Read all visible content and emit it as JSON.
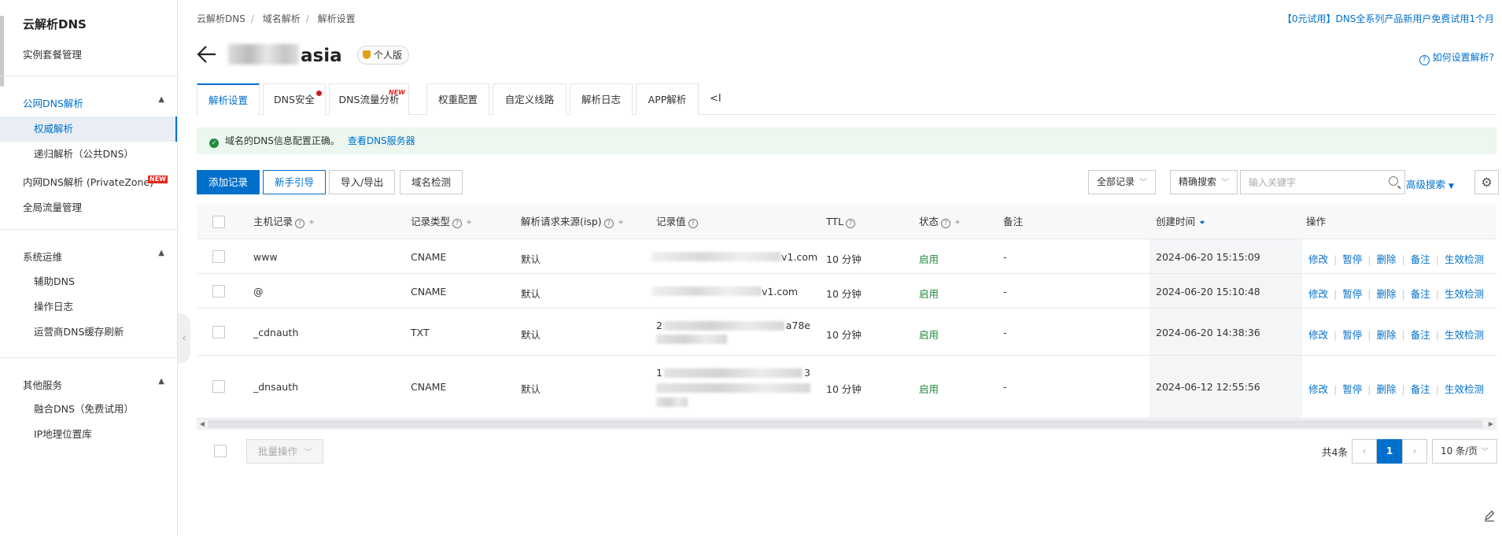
{
  "sidebar": {
    "title": "云解析DNS",
    "instance_link": "实例套餐管理",
    "groups": [
      {
        "label": "公网DNS解析",
        "items": [
          "权威解析",
          "递归解析（公共DNS）"
        ]
      },
      {
        "label": "内网DNS解析 (PrivateZone)",
        "badge": "NEW"
      },
      {
        "label": "全局流量管理"
      },
      {
        "label": "系统运维",
        "items": [
          "辅助DNS",
          "操作日志",
          "运营商DNS缓存刷新"
        ]
      },
      {
        "label": "其他服务",
        "items": [
          "融合DNS（免费试用）",
          "IP地理位置库"
        ]
      }
    ]
  },
  "breadcrumb": [
    "云解析DNS",
    "域名解析",
    "解析设置"
  ],
  "promo": "【0元试用】DNS全系列产品新用户免费试用1个月",
  "domain": {
    "visible_suffix": "asia",
    "edition": "个人版"
  },
  "help_link": "如何设置解析?",
  "tabs": [
    {
      "label": "解析设置",
      "active": true
    },
    {
      "label": "DNS安全",
      "dot": true
    },
    {
      "label": "DNS流量分析",
      "new": "NEW"
    },
    {
      "label": "权重配置"
    },
    {
      "label": "自定义线路"
    },
    {
      "label": "解析日志"
    },
    {
      "label": "APP解析"
    }
  ],
  "tab_collapse": "<I",
  "alert": {
    "text": "域名的DNS信息配置正确。",
    "link": "查看DNS服务器"
  },
  "toolbar": {
    "add": "添加记录",
    "guide": "新手引导",
    "import_export": "导入/导出",
    "check": "域名检测",
    "filter_all": "全部记录",
    "exact_search": "精确搜索",
    "search_placeholder": "输入关键字",
    "advanced": "高级搜索"
  },
  "table": {
    "headers": {
      "host": "主机记录",
      "type": "记录类型",
      "isp": "解析请求来源(isp)",
      "value": "记录值",
      "ttl": "TTL",
      "status": "状态",
      "remark": "备注",
      "created": "创建时间",
      "ops": "操作"
    },
    "rows": [
      {
        "host": "www",
        "type": "CNAME",
        "isp": "默认",
        "value_suffix": "v1.com",
        "ttl": "10 分钟",
        "status": "启用",
        "remark": "-",
        "created": "2024-06-20 15:15:09"
      },
      {
        "host": "@",
        "type": "CNAME",
        "isp": "默认",
        "value_suffix": "v1.com",
        "ttl": "10 分钟",
        "status": "启用",
        "remark": "-",
        "created": "2024-06-20 15:10:48"
      },
      {
        "host": "_cdnauth",
        "type": "TXT",
        "isp": "默认",
        "value_prefix": "2",
        "value_suffix": "a78e",
        "ttl": "10 分钟",
        "status": "启用",
        "remark": "-",
        "created": "2024-06-20 14:38:36"
      },
      {
        "host": "_dnsauth",
        "type": "CNAME",
        "isp": "默认",
        "value_prefix": "1",
        "value_suffix": "3",
        "ttl": "10 分钟",
        "status": "启用",
        "remark": "-",
        "created": "2024-06-12 12:55:56"
      }
    ],
    "ops": [
      "修改",
      "暂停",
      "删除",
      "备注",
      "生效检测"
    ]
  },
  "footer": {
    "batch": "批量操作",
    "total": "共4条",
    "current_page": "1",
    "page_size": "10 条/页"
  },
  "colors": {
    "accent": "#0070cc",
    "success": "#1f8a3e",
    "alert_bg": "#ebf7ef"
  }
}
